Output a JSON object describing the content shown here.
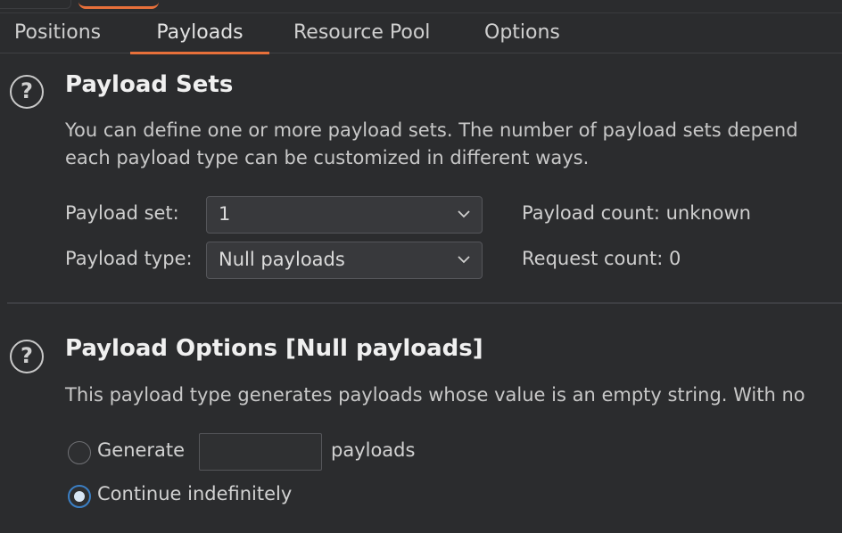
{
  "tabs": [
    "Positions",
    "Payloads",
    "Resource Pool",
    "Options"
  ],
  "active_tab": "Payloads",
  "accent_color": "#e8703a",
  "payload_sets": {
    "title": "Payload Sets",
    "description_line1": "You can define one or more payload sets. The number of payload sets depend",
    "description_line2": "each payload type can be customized in different ways.",
    "set_label": "Payload set:",
    "set_value": "1",
    "type_label": "Payload type:",
    "type_value": "Null payloads",
    "payload_count": "Payload count: unknown",
    "request_count": "Request count: 0",
    "help_icon_glyph": "?"
  },
  "payload_options": {
    "title": "Payload Options [Null payloads]",
    "description": "This payload type generates payloads whose value is an empty string. With no",
    "generate_label": "Generate",
    "generate_value": "",
    "payloads_suffix": "payloads",
    "continue_label": "Continue indefinitely",
    "selected_option": "Continue indefinitely",
    "help_icon_glyph": "?"
  },
  "icons": {
    "help": "help-circle-icon",
    "dropdown": "chevron-down-icon"
  }
}
